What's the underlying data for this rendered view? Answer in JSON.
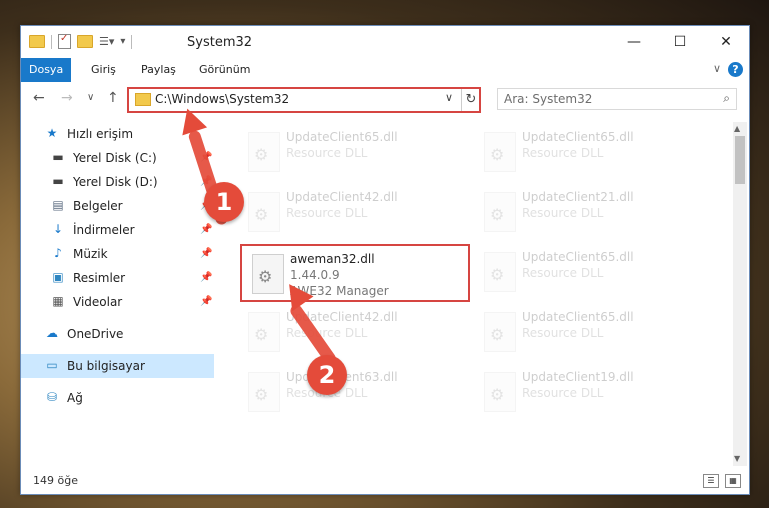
{
  "window": {
    "title": "System32",
    "minimize_glyph": "—",
    "maximize_glyph": "☐",
    "close_glyph": "✕"
  },
  "ribbon": {
    "tabs": [
      "Dosya",
      "Giriş",
      "Paylaş",
      "Görünüm"
    ],
    "help_glyph": "?",
    "collapse_glyph": "∨"
  },
  "nav": {
    "back_glyph": "←",
    "forward_glyph": "→",
    "recent_glyph": "∨",
    "up_glyph": "↑",
    "address": "C:\\Windows\\System32",
    "address_dropdown_glyph": "∨",
    "refresh_glyph": "↻",
    "search_placeholder": "Ara: System32",
    "search_glyph": "⌕"
  },
  "sidebar": {
    "items": [
      {
        "label": "Hızlı erişim",
        "icon": "star-icon",
        "glyph": "★",
        "color": "#1979ca",
        "pinned": false
      },
      {
        "label": "Yerel Disk (C:)",
        "icon": "drive-icon",
        "glyph": "▬",
        "color": "#444444",
        "pinned": true
      },
      {
        "label": "Yerel Disk (D:)",
        "icon": "drive-icon",
        "glyph": "▬",
        "color": "#444444",
        "pinned": true
      },
      {
        "label": "Belgeler",
        "icon": "documents-icon",
        "glyph": "▤",
        "color": "#5b6b80",
        "pinned": true
      },
      {
        "label": "İndirmeler",
        "icon": "download-icon",
        "glyph": "↓",
        "color": "#1979ca",
        "pinned": true
      },
      {
        "label": "Müzik",
        "icon": "music-icon",
        "glyph": "♪",
        "color": "#1979ca",
        "pinned": true
      },
      {
        "label": "Resimler",
        "icon": "pictures-icon",
        "glyph": "▣",
        "color": "#2e86c1",
        "pinned": true
      },
      {
        "label": "Videolar",
        "icon": "video-icon",
        "glyph": "▦",
        "color": "#555555",
        "pinned": true
      },
      {
        "label": "OneDrive",
        "icon": "cloud-icon",
        "glyph": "☁",
        "color": "#1979ca",
        "pinned": false
      },
      {
        "label": "Bu bilgisayar",
        "icon": "computer-icon",
        "glyph": "▭",
        "color": "#2e86c1",
        "pinned": false
      },
      {
        "label": "Ağ",
        "icon": "network-icon",
        "glyph": "⛁",
        "color": "#2e86c1",
        "pinned": false
      }
    ],
    "pin_glyph": "📌"
  },
  "files": [
    {
      "name": "UpdateClient65.dll",
      "desc": "Resource DLL",
      "faded": true
    },
    {
      "name": "UpdateClient65.dll",
      "desc": "Resource DLL",
      "faded": true
    },
    {
      "name": "UpdateClient42.dll",
      "desc": "Resource DLL",
      "faded": true
    },
    {
      "name": "UpdateClient21.dll",
      "desc": "Resource DLL",
      "faded": true
    },
    {
      "name": "aweman32.dll",
      "desc": "1.44.0.9",
      "extra": "AWE32 Manager",
      "faded": false
    },
    {
      "name": "UpdateClient65.dll",
      "desc": "Resource DLL",
      "faded": true
    },
    {
      "name": "UpdateClient42.dll",
      "desc": "Resource DLL",
      "faded": true
    },
    {
      "name": "UpdateClient65.dll",
      "desc": "Resource DLL",
      "faded": true
    },
    {
      "name": "UpdateClient63.dll",
      "desc": "Resource DLL",
      "faded": true
    },
    {
      "name": "UpdateClient19.dll",
      "desc": "Resource DLL",
      "faded": true
    }
  ],
  "status": {
    "count_text": "149 öğe"
  },
  "annotations": {
    "step1": "1",
    "step2": "2",
    "accent": "#e44b3a"
  }
}
